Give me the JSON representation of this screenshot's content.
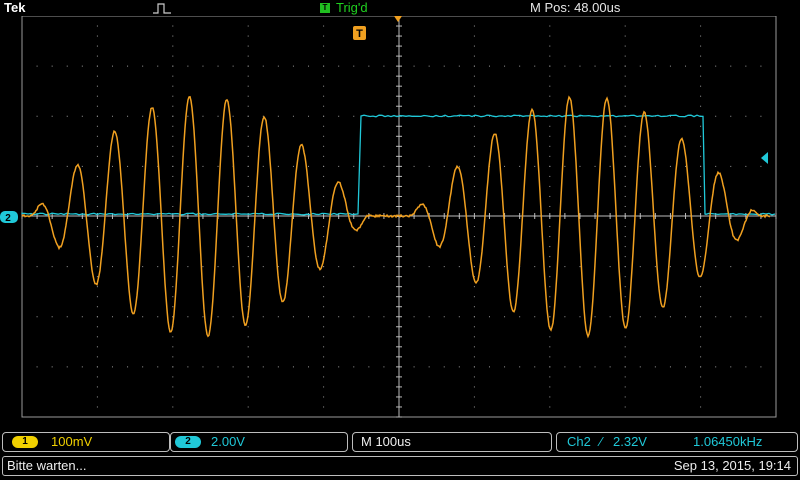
{
  "header": {
    "brand": "Tek",
    "trigger_badge": "T",
    "trigger_state": "Trig'd",
    "position_readout": "M Pos: 48.00us"
  },
  "screen": {
    "trigger_marker": "T",
    "ch2_ground_marker": "2"
  },
  "channels": {
    "ch1": {
      "badge": "1",
      "scale": "100mV",
      "color": "#f0a020"
    },
    "ch2": {
      "badge": "2",
      "scale": "2.00V",
      "color": "#20c8d8"
    }
  },
  "horizontal": {
    "timebase": "M 100us"
  },
  "trigger": {
    "source": "Ch2",
    "slope_symbol": "∕",
    "level": "2.32V",
    "frequency": "1.06450kHz"
  },
  "status": {
    "message": "Bitte warten...",
    "datetime": "Sep 13, 2015, 19:14"
  },
  "colors": {
    "graticule": "#9a9a9a",
    "trig_green": "#20c020",
    "trigger_marker": "#f0a020"
  }
}
